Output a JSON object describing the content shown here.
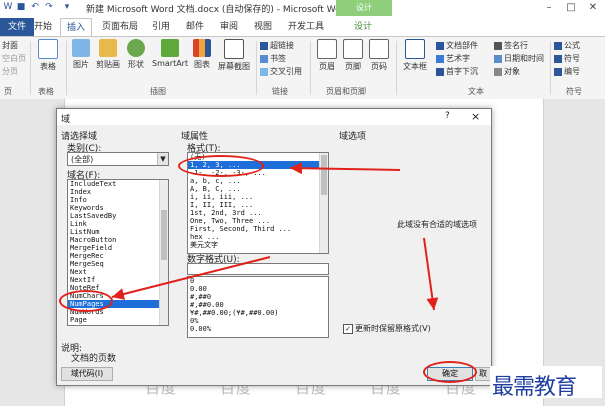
{
  "window": {
    "title": "新建 Microsoft Word 文档.docx (自动保存的) - Microsoft Word",
    "contextual_tab": "设计",
    "quick_access": [
      "W",
      "↶",
      "↷",
      "▾"
    ]
  },
  "tabs": [
    "文件",
    "开始",
    "插入",
    "页面布局",
    "引用",
    "邮件",
    "审阅",
    "视图",
    "开发工具"
  ],
  "active_tab": "插入",
  "ribbon": {
    "left_items": [
      "封面",
      "空白页",
      "分页"
    ],
    "left_group": "页",
    "table": "表格",
    "table_group": "表格",
    "illustrations": [
      "图片",
      "剪贴画",
      "形状",
      "SmartArt",
      "图表",
      "屏幕截图"
    ],
    "illustrations_group": "插图",
    "links": [
      "超链接",
      "书签",
      "交叉引用"
    ],
    "links_group": "链接",
    "header_footer": [
      "页眉",
      "页脚",
      "页码"
    ],
    "header_footer_group": "页眉和页脚",
    "text_box": "文本框",
    "text_small": [
      "文档部件",
      "艺术字",
      "首字下沉",
      "签名行",
      "日期和时间",
      "对象"
    ],
    "text_group": "文本",
    "symbols": [
      "公式",
      "符号",
      "编号"
    ],
    "symbols_group": "符号"
  },
  "dialog": {
    "title": "域",
    "help": "?",
    "close": "×",
    "choose_field": "请选择域",
    "category_label": "类别(C):",
    "category_value": "(全部)",
    "field_names_label": "域名(F):",
    "field_names": [
      "IncludeText",
      "Index",
      "Info",
      "Keywords",
      "LastSavedBy",
      "Link",
      "ListNum",
      "MacroButton",
      "MergeField",
      "MergeRec",
      "MergeSeq",
      "Next",
      "NextIf",
      "NoteRef",
      "NumChars",
      "NumPages",
      "NumWords",
      "Page"
    ],
    "selected_field": "NumPages",
    "field_props_label": "域属性",
    "format_label": "格式(T):",
    "formats": [
      "(无)",
      "1, 2, 3, ...",
      "-1-, -2-, -3-, ...",
      "a, b, c, ...",
      "A, B, C, ...",
      "i, ii, iii, ...",
      "I, II, III, ...",
      "1st, 2nd, 3rd ...",
      "One, Two, Three ...",
      "First, Second, Third ...",
      "hex ...",
      "美元文字"
    ],
    "selected_format": "1, 2, 3, ...",
    "numeric_format_label": "数字格式(U):",
    "numeric_formats": [
      "0",
      "0.00",
      "#,##0",
      "#,##0.00",
      "¥#,##0.00;(¥#,##0.00)",
      "0%",
      "0.00%"
    ],
    "field_options_label": "域选项",
    "no_options": "此域没有合适的域选项",
    "preserve_label": "更新时保留原格式(V)",
    "preserve_checked": true,
    "description_label": "说明:",
    "description": "文档的页数",
    "field_codes_button": "域代码(I)",
    "ok_button": "确定",
    "cancel_button": "取消"
  },
  "document": {
    "watermark": [
      "百度",
      "百度",
      "百度",
      "百度",
      "百度"
    ]
  },
  "brand_overlay": "最需教育",
  "colors": {
    "accent": "#2b579a",
    "annotation": "#e0221b",
    "selection": "#1e6fd9",
    "contextual": "#8fcf7b"
  }
}
